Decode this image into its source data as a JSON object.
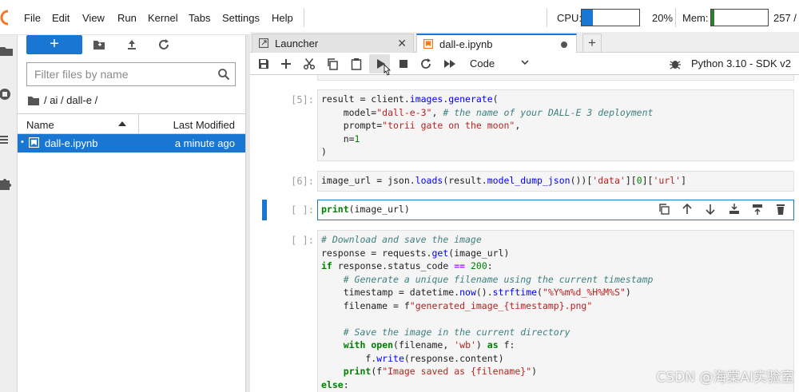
{
  "menubar": {
    "items": [
      "File",
      "Edit",
      "View",
      "Run",
      "Kernel",
      "Tabs",
      "Settings",
      "Help"
    ],
    "cpu": {
      "label": "CPU:",
      "value": "20%",
      "fraction": 0.2
    },
    "mem": {
      "label": "Mem:",
      "value": "257 /",
      "fraction": 0.05
    }
  },
  "rail": {
    "icons": [
      "folder-icon",
      "running-icon",
      "toc-icon",
      "extension-icon"
    ]
  },
  "filebrowser": {
    "new_label": "+",
    "filter_placeholder": "Filter files by name",
    "breadcrumb": "/ ai / dall-e /",
    "col_name": "Name",
    "col_modified": "Last Modified",
    "files": [
      {
        "marker": "•",
        "name": "dall-e.ipynb",
        "modified": "a minute ago"
      }
    ]
  },
  "tabs": [
    {
      "label": "Launcher"
    },
    {
      "label": "dall-e.ipynb"
    }
  ],
  "toolbar": {
    "cell_type": "Code",
    "kernel": "Python 3.10 - SDK v2"
  },
  "cells": [
    {
      "prompt": "[5]:",
      "lines": [
        "result = client.images.generate(",
        "    model=\"dall-e-3\", # the name of your DALL-E 3 deployment",
        "    prompt=\"torii gate on the moon\",",
        "    n=1",
        ")"
      ]
    },
    {
      "prompt": "[6]:",
      "lines": [
        "image_url = json.loads(result.model_dump_json())['data'][0]['url']"
      ]
    },
    {
      "prompt": "[ ]:",
      "lines": [
        "print(image_url)"
      ]
    },
    {
      "prompt": "[ ]:",
      "lines": [
        "# Download and save the image",
        "response = requests.get(image_url)",
        "if response.status_code == 200:",
        "    # Generate a unique filename using the current timestamp",
        "    timestamp = datetime.now().strftime(\"%Y%m%d_%H%M%S\")",
        "    filename = f\"generated_image_{timestamp}.png\"",
        "",
        "    # Save the image in the current directory",
        "    with open(filename, 'wb') as f:",
        "        f.write(response.content)",
        "    print(f\"Image saved as {filename}\")",
        "else:"
      ]
    }
  ],
  "watermark": "CSDN @海棠AI实验室",
  "colors": {
    "accent": "#1976d2",
    "mem": "#2e7d32"
  }
}
